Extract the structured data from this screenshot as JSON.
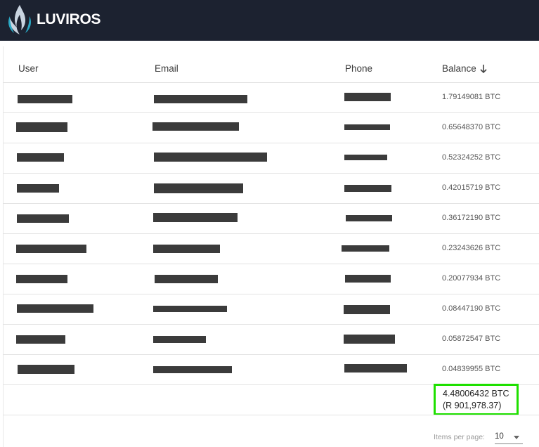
{
  "app": {
    "brand": "LUVIROS"
  },
  "table": {
    "headers": {
      "user": "User",
      "email": "Email",
      "phone": "Phone",
      "balance": "Balance"
    },
    "sort": {
      "column": "balance",
      "direction": "descending",
      "icon": "arrow-down-icon"
    },
    "rows": [
      {
        "balance": "1.79149081 BTC"
      },
      {
        "balance": "0.65648370 BTC"
      },
      {
        "balance": "0.52324252 BTC"
      },
      {
        "balance": "0.42015719 BTC"
      },
      {
        "balance": "0.36172190 BTC"
      },
      {
        "balance": "0.23243626 BTC"
      },
      {
        "balance": "0.20077934 BTC"
      },
      {
        "balance": "0.08447190 BTC"
      },
      {
        "balance": "0.05872547 BTC"
      },
      {
        "balance": "0.04839955 BTC"
      }
    ],
    "total": {
      "btc": "4.48006432 BTC",
      "fiat": "(R 901,978.37)",
      "highlight_color": "#1fe000"
    }
  },
  "pagination": {
    "items_per_page_label": "Items per page:",
    "items_per_page_value": "10"
  },
  "colors": {
    "header_bg": "#1c2230",
    "redaction": "#3b3b3b"
  }
}
